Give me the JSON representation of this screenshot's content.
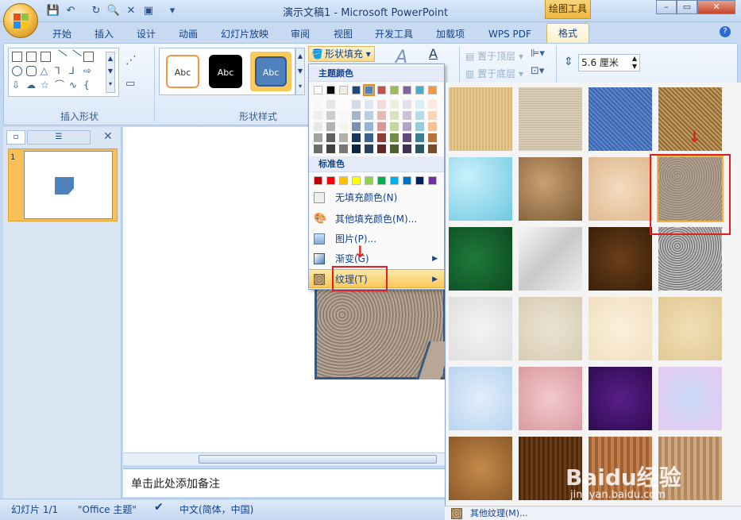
{
  "window": {
    "title": "演示文稿1 - Microsoft PowerPoint",
    "tools_tab": "绘图工具"
  },
  "tabs": [
    "开始",
    "插入",
    "设计",
    "动画",
    "幻灯片放映",
    "审阅",
    "视图",
    "开发工具",
    "加载项",
    "WPS PDF",
    "格式"
  ],
  "ribbon": {
    "insert_shapes_label": "插入形状",
    "shape_styles_label": "形状样式",
    "style_thumbs": [
      "Abc",
      "Abc",
      "Abc"
    ],
    "fill_button": "形状填充",
    "bring_front": "置于顶层",
    "send_back": "置于底层",
    "size_value": "5.6 厘米"
  },
  "fill_menu": {
    "theme_colors_label": "主题颜色",
    "standard_colors_label": "标准色",
    "theme_top_row": [
      "#ffffff",
      "#000000",
      "#eeece1",
      "#1f497d",
      "#4f81bd",
      "#c0504d",
      "#9bbb59",
      "#8064a2",
      "#4bacc6",
      "#f79646"
    ],
    "standard_colors": [
      "#c00000",
      "#ff0000",
      "#ffc000",
      "#ffff00",
      "#92d050",
      "#00b050",
      "#00b0f0",
      "#0070c0",
      "#002060",
      "#7030a0"
    ],
    "items": [
      "无填充颜色(N)",
      "其他填充颜色(M)...",
      "图片(P)...",
      "渐变(G)",
      "纹理(T)"
    ]
  },
  "texture_panel": {
    "more_label": "其他纹理(M)..."
  },
  "slides_panel": {
    "slide_number": "1"
  },
  "notes_placeholder": "单击此处添加备注",
  "status": {
    "slide": "幻灯片 1/1",
    "theme": "\"Office 主题\"",
    "language": "中文(简体，中国)"
  },
  "watermark": {
    "text": "Baidu经验",
    "url": "jingyan.baidu.com"
  }
}
